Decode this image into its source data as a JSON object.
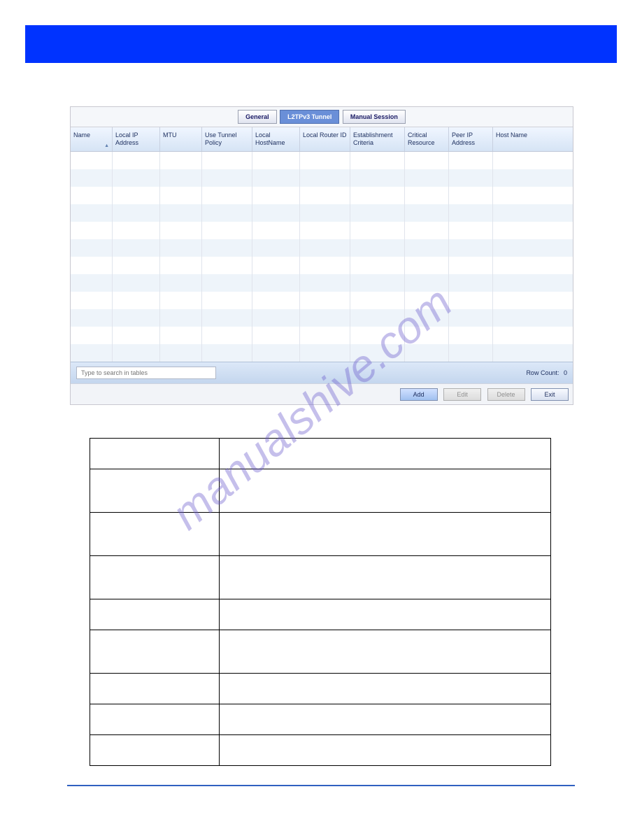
{
  "tabs": {
    "general": "General",
    "l2tpv3": "L2TPv3 Tunnel",
    "manual": "Manual Session"
  },
  "columns": [
    "Name",
    "Local IP Address",
    "MTU",
    "Use Tunnel Policy",
    "Local HostName",
    "Local Router ID",
    "Establishment Criteria",
    "Critical Resource",
    "Peer IP Address",
    "Host Name"
  ],
  "search": {
    "placeholder": "Type to search in tables"
  },
  "rowcount": {
    "label": "Row Count:",
    "value": "0"
  },
  "buttons": {
    "add": "Add",
    "edit": "Edit",
    "delete": "Delete",
    "exit": "Exit"
  },
  "watermark": "manualshive.com"
}
